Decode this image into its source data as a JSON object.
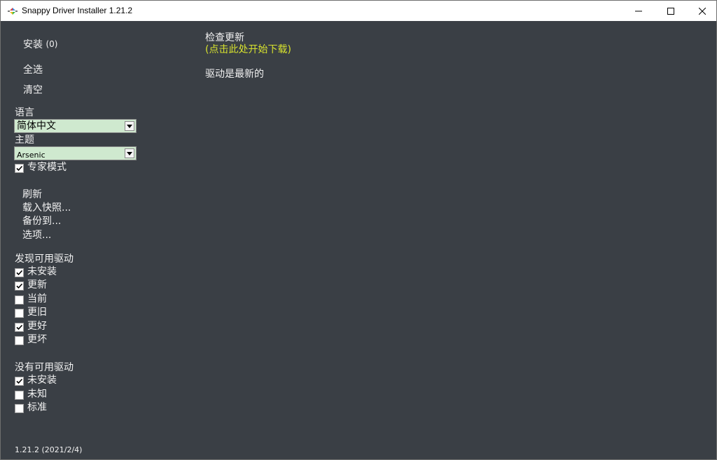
{
  "window": {
    "title": "Snappy Driver Installer 1.21.2",
    "app_icon": "snappy-logo-icon"
  },
  "sidebar": {
    "install_label": "安装",
    "install_count": "(0)",
    "select_all_label": "全选",
    "clear_label": "清空",
    "language_label": "语言",
    "language_value": "简体中文",
    "theme_label": "主题",
    "theme_value": "Arsenic",
    "expert_mode_label": "专家模式",
    "expert_mode_checked": true,
    "refresh_label": "刷新",
    "load_snapshot_label": "载入快照...",
    "backup_label": "备份到...",
    "options_label": "选项...",
    "found_drivers_header": "发现可用驱动",
    "found_filters": [
      {
        "label": "未安装",
        "checked": true
      },
      {
        "label": "更新",
        "checked": true
      },
      {
        "label": "当前",
        "checked": false
      },
      {
        "label": "更旧",
        "checked": false
      },
      {
        "label": "更好",
        "checked": true
      },
      {
        "label": "更坏",
        "checked": false
      }
    ],
    "no_drivers_header": "没有可用驱动",
    "no_driver_filters": [
      {
        "label": "未安装",
        "checked": true
      },
      {
        "label": "未知",
        "checked": false
      },
      {
        "label": "标准",
        "checked": false
      }
    ],
    "version": "1.21.2 (2021/2/4)"
  },
  "main": {
    "check_updates_title": "检查更新",
    "check_updates_link": "(点击此处开始下载)",
    "status_text": "驱动是最新的"
  },
  "colors": {
    "background": "#3a3f45",
    "text": "#f2f2f2",
    "link": "#d7e22e",
    "combo_bg": "#cfe9cf"
  }
}
